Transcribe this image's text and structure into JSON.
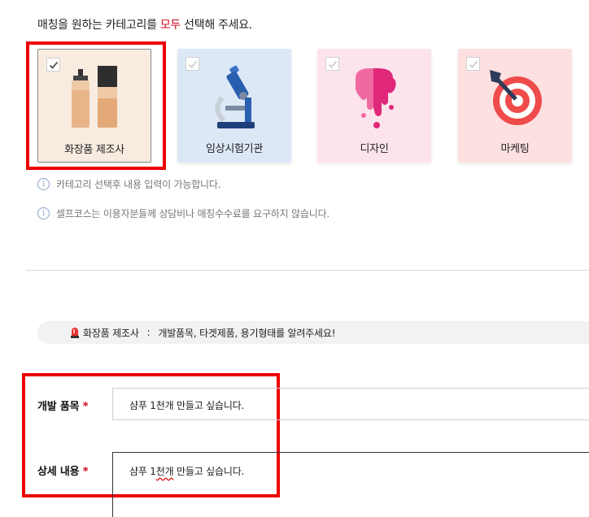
{
  "instruction": {
    "before": "매칭을 원하는 카테고리를 ",
    "highlight": "모두",
    "after": " 선택해 주세요."
  },
  "categories": [
    {
      "label": "화장품 제조사",
      "selected": true,
      "bg": "#f8ece0",
      "icon": "cosmetic-bottles-icon"
    },
    {
      "label": "임상시험기관",
      "selected": false,
      "bg": "#dde8f7",
      "icon": "microscope-icon"
    },
    {
      "label": "디자인",
      "selected": false,
      "bg": "#fde4ec",
      "icon": "paint-drip-icon"
    },
    {
      "label": "마케팅",
      "selected": false,
      "bg": "#fde0e0",
      "icon": "target-dart-icon"
    }
  ],
  "info": [
    "카테고리 선택후 내용 입력이 가능합니다.",
    "셀프코스는 이용자분들께 상담비나 매칭수수료를 요구하지 않습니다."
  ],
  "notice": {
    "category": "화장품 제조사",
    "separator": ":",
    "message": "개발품목, 타겟제품, 용기형태를 알려주세요!"
  },
  "form": {
    "product_label": "개발 품목",
    "product_value": "샴푸 1천개 만들고 싶습니다.",
    "detail_label": "상세 내용",
    "detail_value_a": "샴푸 1",
    "detail_value_b": "천개",
    "detail_value_c": " 만들고 싶습니다.",
    "required_mark": "*"
  },
  "colors": {
    "accent_red": "#d0021b",
    "highlight_box": "#ee0000",
    "focus_underline": "#3a6fc4"
  }
}
